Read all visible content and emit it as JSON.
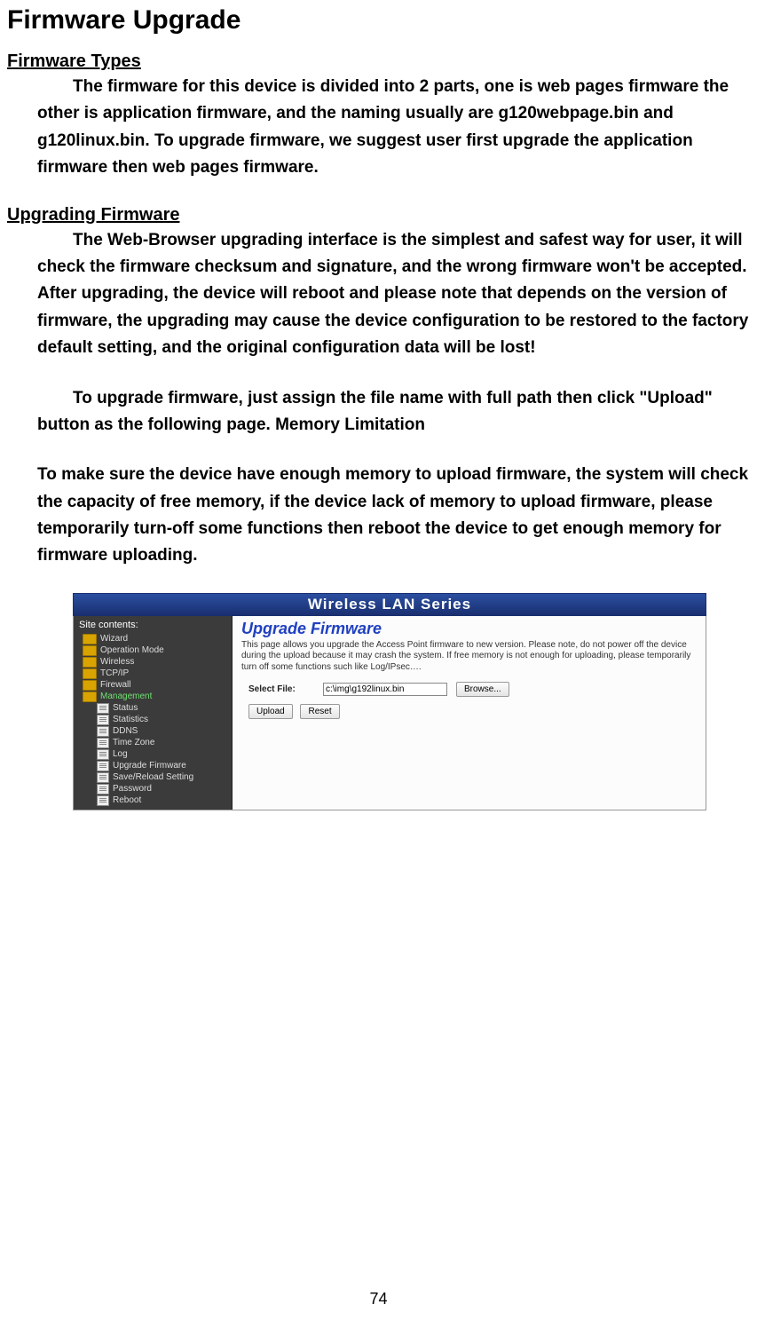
{
  "page": {
    "title": "Firmware Upgrade",
    "section1": {
      "heading": "Firmware Types",
      "body": "The firmware for this device is divided into 2 parts, one is web pages firmware the other is application firmware, and the naming usually are g120webpage.bin and g120linux.bin. To upgrade firmware, we suggest user first upgrade the application firmware then web pages firmware."
    },
    "section2": {
      "heading": "Upgrading Firmware",
      "body1": "The Web-Browser upgrading interface is the simplest and safest way for user, it will check the firmware checksum and signature, and the wrong firmware won't be accepted. After upgrading, the device will reboot and please note that depends on the version of firmware, the upgrading may cause the device configuration to be restored to the factory default setting, and the original configuration data will be lost!",
      "body2": "To upgrade firmware, just assign the file name with full path then click \"Upload\" button as the following page. Memory Limitation",
      "body3": "To make sure the device have enough memory to upload firmware, the system will check the capacity of free memory, if the device lack of memory to upload firmware, please temporarily turn-off some functions then reboot the device to get enough memory for firmware uploading."
    },
    "page_number": "74"
  },
  "screenshot": {
    "window_title": "Wireless LAN Series",
    "sidebar": {
      "title": "Site contents:",
      "items": [
        {
          "label": "Wizard",
          "type": "folder"
        },
        {
          "label": "Operation Mode",
          "type": "folder"
        },
        {
          "label": "Wireless",
          "type": "folder"
        },
        {
          "label": "TCP/IP",
          "type": "folder"
        },
        {
          "label": "Firewall",
          "type": "folder"
        },
        {
          "label": "Management",
          "type": "folder",
          "active": true
        }
      ],
      "sub_items": [
        "Status",
        "Statistics",
        "DDNS",
        "Time Zone",
        "Log",
        "Upgrade Firmware",
        "Save/Reload Setting",
        "Password",
        "Reboot"
      ]
    },
    "content": {
      "heading": "Upgrade Firmware",
      "description": "This page allows you upgrade the Access Point firmware to new version. Please note, do not power off the device during the upload because it may crash the system. If free memory is not enough for uploading, please temporarily turn off some functions such like Log/IPsec….",
      "select_label": "Select File:",
      "file_value": "c:\\img\\g192linux.bin",
      "browse_label": "Browse...",
      "upload_label": "Upload",
      "reset_label": "Reset"
    }
  }
}
